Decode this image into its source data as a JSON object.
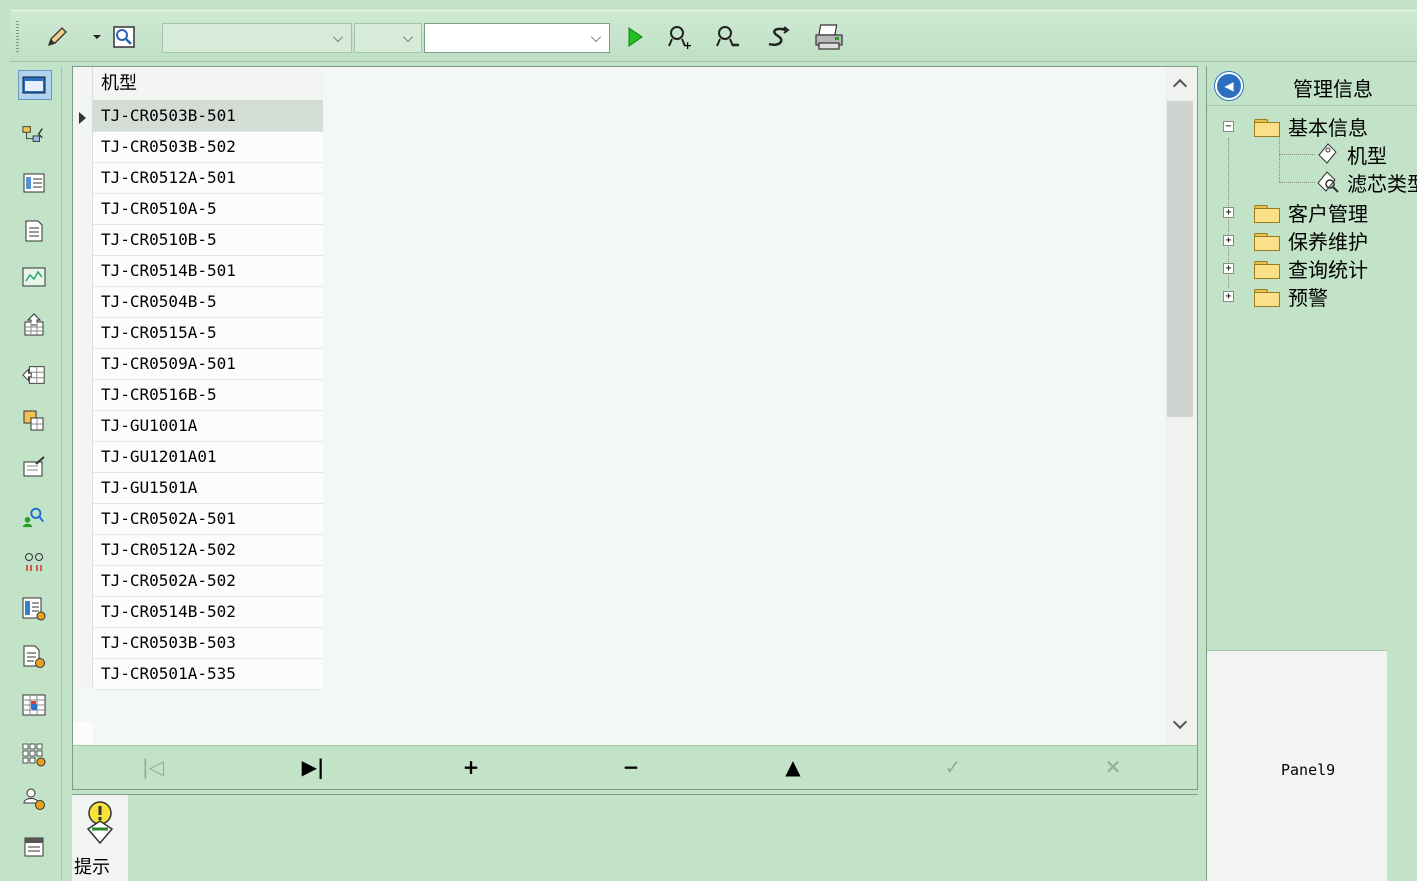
{
  "toolbar": {
    "combo1_value": "",
    "combo2_value": "",
    "combo3_value": ""
  },
  "grid": {
    "header": "机型",
    "rows": [
      "TJ-CR0503B-501",
      "TJ-CR0503B-502",
      "TJ-CR0512A-501",
      "TJ-CR0510A-5",
      "TJ-CR0510B-5",
      "TJ-CR0514B-501",
      "TJ-CR0504B-5",
      "TJ-CR0515A-5",
      "TJ-CR0509A-501",
      "TJ-CR0516B-5",
      "TJ-GU1001A",
      "TJ-GU1201A01",
      "TJ-GU1501A",
      "TJ-CR0502A-501",
      "TJ-CR0512A-502",
      "TJ-CR0502A-502",
      "TJ-CR0514B-502",
      "TJ-CR0503B-503",
      "TJ-CR0501A-535"
    ],
    "selected_index": 0
  },
  "navigator": {
    "first": "|◁",
    "last": "▶|",
    "add": "+",
    "delete": "−",
    "up": "▲",
    "post": "✓",
    "cancel": "✕"
  },
  "hint": {
    "label": "提示"
  },
  "right_panel": {
    "title": "管理信息",
    "tree": {
      "basic_info": "基本信息",
      "model": "机型",
      "filter_type": "滤芯类型",
      "customer_mgmt": "客户管理",
      "maintenance": "保养维护",
      "query_stats": "查询统计",
      "alert": "预警"
    },
    "panel9": "Panel9"
  },
  "colors": {
    "background": "#c2e3c7",
    "grid_background": "#f4f8f4",
    "selection": "#d4dcd6"
  }
}
